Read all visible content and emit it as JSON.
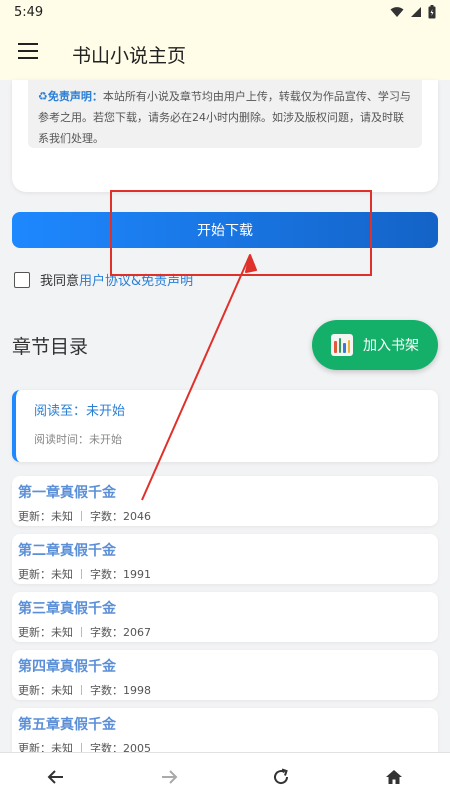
{
  "status_bar": {
    "time": "5:49"
  },
  "app_bar": {
    "title": "书山小说主页",
    "menu_icon": "hamburger-menu-icon"
  },
  "disclaimer": {
    "label": "♻免责声明：",
    "text": "本站所有小说及章节均由用户上传，转载仅为作品宣传、学习与参考之用。若您下载，请务必在24小时内删除。如涉及版权问题，请及时联系我们处理。"
  },
  "download_button": {
    "label": "开始下载"
  },
  "agreement": {
    "prefix": "我同意 ",
    "link": "用户协议&免责声明",
    "checked": false
  },
  "chapter_section": {
    "title": "章节目录"
  },
  "add_shelf_button": {
    "label": "加入书架"
  },
  "reading_progress": {
    "read_to": "阅读至：未开始",
    "read_time": "阅读时间：未开始"
  },
  "chapters": [
    {
      "title": "第一章真假千金",
      "updated": "更新：未知",
      "words": "字数：2046"
    },
    {
      "title": "第二章真假千金",
      "updated": "更新：未知",
      "words": "字数：1991"
    },
    {
      "title": "第三章真假千金",
      "updated": "更新：未知",
      "words": "字数：2067"
    },
    {
      "title": "第四章真假千金",
      "updated": "更新：未知",
      "words": "字数：1998"
    },
    {
      "title": "第五章真假千金",
      "updated": "更新：未知",
      "words": "字数：2005"
    }
  ],
  "colors": {
    "accent": "#1e88ff",
    "shelf_green": "#14b06a",
    "annotation_red": "#e0302a",
    "chapter_title": "#5b8fd8"
  }
}
